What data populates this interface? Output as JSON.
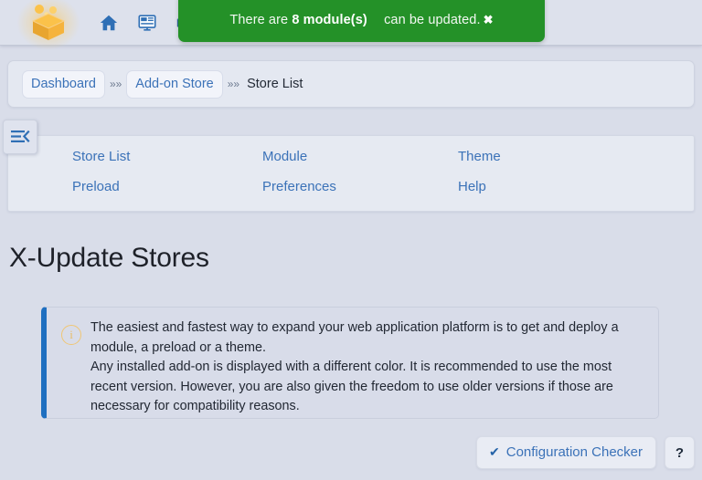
{
  "header": {
    "logo_name": "xoops-cube-logo",
    "icons": [
      {
        "name": "home-icon",
        "label": "Home"
      },
      {
        "name": "monitor-icon",
        "label": "Dashboard"
      },
      {
        "name": "cube-icon",
        "label": "Modules"
      }
    ]
  },
  "toast": {
    "prefix": "There are",
    "highlight": "8 module(s)",
    "suffix": "can be updated.",
    "close_label": "✖",
    "background": "#249128",
    "text_color": "#f3f8f3"
  },
  "breadcrumb": {
    "items": [
      {
        "label": "Dashboard",
        "link": true
      },
      {
        "label": "Add-on Store",
        "link": true
      },
      {
        "label": "Store List",
        "link": false
      }
    ],
    "separator": "»»"
  },
  "sidebar_toggle": {
    "name": "menu-collapse-icon",
    "color": "#2f6fb5"
  },
  "nav": {
    "links": [
      {
        "label": "Store List"
      },
      {
        "label": "Module"
      },
      {
        "label": "Theme"
      },
      {
        "label": "Preload"
      },
      {
        "label": "Preferences"
      },
      {
        "label": "Help"
      }
    ],
    "link_color": "#3b72b8"
  },
  "page": {
    "title": "X-Update Stores"
  },
  "info": {
    "icon": "info-circle-icon",
    "icon_glyph": "i",
    "accent_color": "#1f6fc0",
    "line1": "The easiest and fastest way to expand your web application platform is to get and deploy a module, a preload or a theme.",
    "line2": "Any installed add-on is displayed with a different color. It is recommended to use the most recent version. However, you are also given the freedom to use older versions if those are necessary for compatibility reasons."
  },
  "footer": {
    "config_checker_label": "Configuration Checker",
    "config_checker_icon": "✔",
    "help_label": "?"
  }
}
